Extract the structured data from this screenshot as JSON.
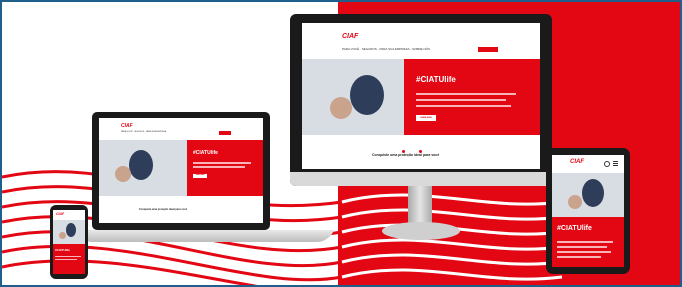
{
  "brand": {
    "logo_text": "CIAF",
    "accent_color": "#e30613",
    "frame_color": "#1f5f8b"
  },
  "website": {
    "hashtag": "#CIATUlife",
    "cta_label": "SAIBA MAIS",
    "section_caption": "Conquiste uma proteção ideal para você",
    "nav_items": [
      "PARA VOCÊ",
      "SEGUROS",
      "PARA SUA EMPRESA",
      "SOBRE NÓS",
      "CONTATO"
    ]
  },
  "devices": [
    "desktop-monitor",
    "laptop",
    "tablet",
    "smartphone"
  ]
}
